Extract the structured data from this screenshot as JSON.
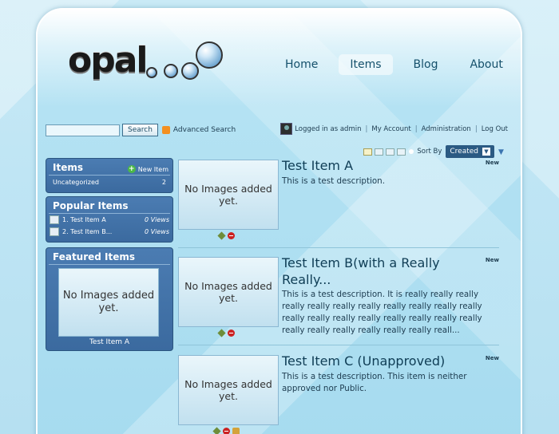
{
  "logo": {
    "text": "opal"
  },
  "nav": {
    "items": [
      {
        "label": "Home",
        "active": false
      },
      {
        "label": "Items",
        "active": true
      },
      {
        "label": "Blog",
        "active": false
      },
      {
        "label": "About",
        "active": false
      }
    ]
  },
  "search": {
    "button_label": "Search",
    "advanced_label": "Advanced Search",
    "value": ""
  },
  "user": {
    "logged_in": "Logged in as admin",
    "my_account": "My Account",
    "administration": "Administration",
    "logout": "Log Out"
  },
  "view": {
    "sort_label": "Sort By",
    "sort_value": "Created"
  },
  "sidebar": {
    "items_box": {
      "title": "Items",
      "new_item": "New Item",
      "rows": [
        {
          "label": "Uncategorized",
          "count": "2"
        }
      ]
    },
    "popular": {
      "title": "Popular Items",
      "rows": [
        {
          "label": "1. Test Item A",
          "views": "0 Views"
        },
        {
          "label": "2. Test Item B...",
          "views": "0 Views"
        }
      ]
    },
    "featured": {
      "title": "Featured Items",
      "image_text": "No Images added yet.",
      "caption": "Test Item A"
    }
  },
  "items": [
    {
      "title": "Test Item A",
      "description": "This is a test description.",
      "badge": "New",
      "image_text": "No Images added yet."
    },
    {
      "title": "Test Item B(with a Really Really...",
      "description": "This is a test description. It is really really really really really really really really really really really really really really really really really really really really really really really really really reall...",
      "badge": "New",
      "image_text": "No Images added yet."
    },
    {
      "title": "Test Item C (Unapproved)",
      "description": "This is a test description. This item is neither approved nor Public.",
      "badge": "New",
      "image_text": "No Images added yet."
    }
  ],
  "colors": {
    "accent": "#2b5a83",
    "sidebar": "#3b6a9f",
    "text": "#0f3d55"
  }
}
